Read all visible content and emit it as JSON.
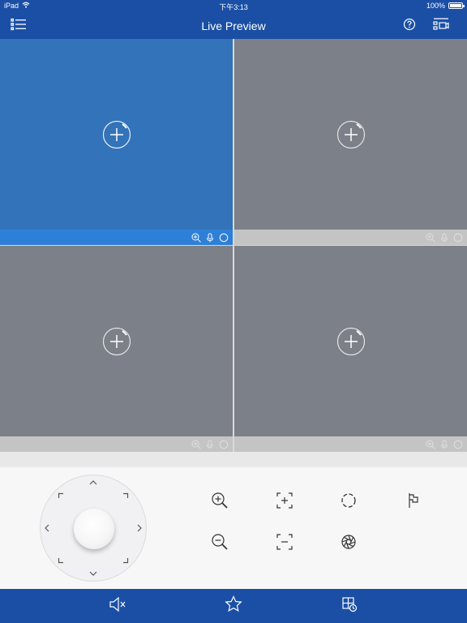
{
  "statusbar": {
    "device": "iPad",
    "time": "下午3:13",
    "battery": "100%"
  },
  "navbar": {
    "title": "Live Preview",
    "menu_icon": "list-icon",
    "help_icon": "help-icon",
    "layout_icon": "device-list-icon"
  },
  "cells": [
    {
      "state": "selected"
    },
    {
      "state": "empty"
    },
    {
      "state": "empty"
    },
    {
      "state": "empty"
    }
  ],
  "ptz_controls": [
    {
      "name": "zoom-in",
      "icon": "zoom-in-icon"
    },
    {
      "name": "focus-near",
      "icon": "focus-plus-icon"
    },
    {
      "name": "iris-open",
      "icon": "iris-open-icon"
    },
    {
      "name": "preset",
      "icon": "flag-icon"
    },
    {
      "name": "zoom-out",
      "icon": "zoom-out-icon"
    },
    {
      "name": "focus-far",
      "icon": "focus-minus-icon"
    },
    {
      "name": "iris-close",
      "icon": "iris-close-icon"
    }
  ],
  "tabbar": [
    {
      "name": "mute",
      "icon": "speaker-mute-icon"
    },
    {
      "name": "favorite",
      "icon": "star-icon"
    },
    {
      "name": "layout",
      "icon": "window-layout-icon"
    }
  ],
  "colors": {
    "brand": "#1a4fa5",
    "selected_cell": "#3273b9",
    "selected_bar": "#2e7fd8",
    "empty_cell": "#7c8088"
  }
}
